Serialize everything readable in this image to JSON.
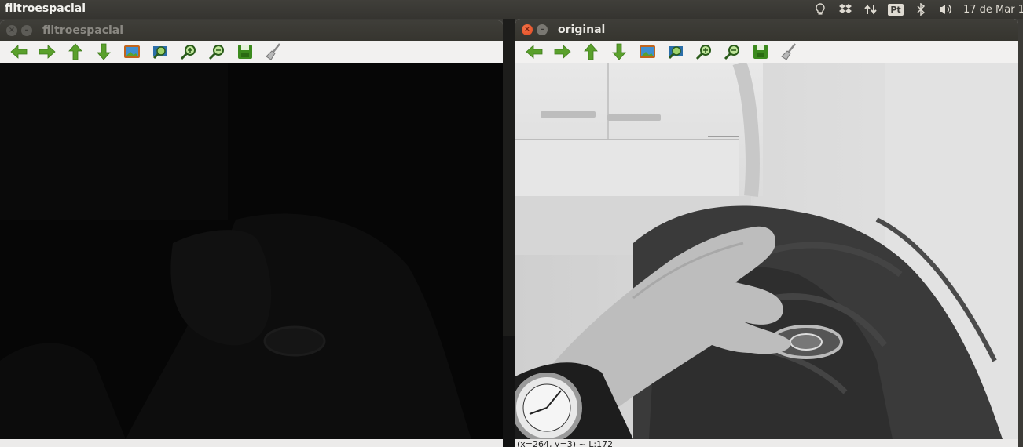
{
  "panel": {
    "app_title": "filtroespacial",
    "tray_icons": [
      "lightbulb-icon",
      "dropbox-icon",
      "network-icon",
      "input-method-icon",
      "bluetooth-icon",
      "volume-icon"
    ],
    "input_method_label": "Pt",
    "clock": "17 de Mar 1"
  },
  "windows": {
    "left": {
      "title": "filtroespacial"
    },
    "right": {
      "title": "original",
      "status": "(x=264, y=3) ~ L:172"
    }
  },
  "toolbar": {
    "buttons": [
      {
        "name": "pan-left-button",
        "icon": "arrow-left-icon"
      },
      {
        "name": "pan-right-button",
        "icon": "arrow-right-icon"
      },
      {
        "name": "pan-up-button",
        "icon": "arrow-up-icon"
      },
      {
        "name": "pan-down-button",
        "icon": "arrow-down-icon"
      },
      {
        "name": "zoom-fit-button",
        "icon": "image-icon"
      },
      {
        "name": "zoom-original-button",
        "icon": "zoom-image-icon"
      },
      {
        "name": "zoom-in-button",
        "icon": "zoom-in-icon"
      },
      {
        "name": "zoom-out-button",
        "icon": "zoom-out-icon"
      },
      {
        "name": "save-button",
        "icon": "save-icon"
      },
      {
        "name": "properties-button",
        "icon": "brush-icon"
      }
    ]
  },
  "colors": {
    "toolbar_icon_green": "#5aa02c",
    "close_button_orange": "#e8542a"
  }
}
